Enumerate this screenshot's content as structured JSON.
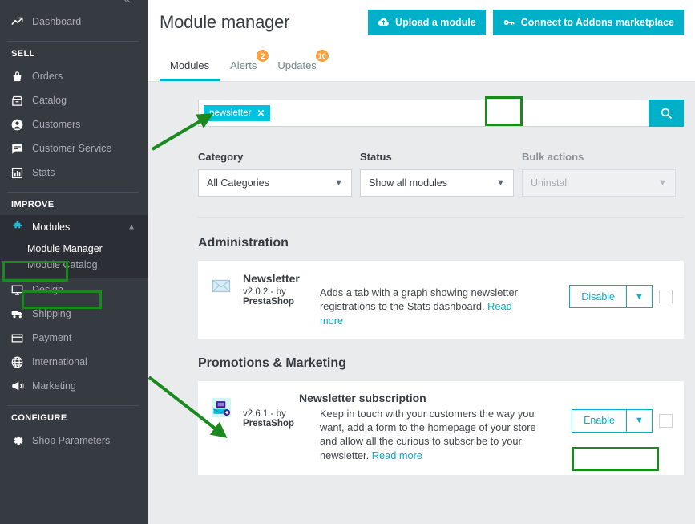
{
  "sidebar": {
    "collapse_icon": "double-chevron-left",
    "dashboard": {
      "label": "Dashboard",
      "icon": "trending-up-icon"
    },
    "sell_header": "SELL",
    "sell_items": [
      {
        "label": "Orders",
        "icon": "basket-icon"
      },
      {
        "label": "Catalog",
        "icon": "store-icon"
      },
      {
        "label": "Customers",
        "icon": "user-circle-icon"
      },
      {
        "label": "Customer Service",
        "icon": "chat-icon"
      },
      {
        "label": "Stats",
        "icon": "bar-chart-icon"
      }
    ],
    "improve_header": "IMPROVE",
    "modules": {
      "label": "Modules",
      "icon": "puzzle-icon"
    },
    "modules_sub": [
      {
        "label": "Module Manager",
        "active": true
      },
      {
        "label": "Module Catalog",
        "active": false
      }
    ],
    "improve_items": [
      {
        "label": "Design",
        "icon": "monitor-icon"
      },
      {
        "label": "Shipping",
        "icon": "truck-icon"
      },
      {
        "label": "Payment",
        "icon": "credit-card-icon"
      },
      {
        "label": "International",
        "icon": "globe-icon"
      },
      {
        "label": "Marketing",
        "icon": "megaphone-icon"
      }
    ],
    "configure_header": "CONFIGURE",
    "configure_items": [
      {
        "label": "Shop Parameters",
        "icon": "gear-icon"
      }
    ]
  },
  "header": {
    "title": "Module manager",
    "upload_label": "Upload a module",
    "connect_label": "Connect to Addons marketplace"
  },
  "tabs": [
    {
      "label": "Modules",
      "badge": "",
      "active": true
    },
    {
      "label": "Alerts",
      "badge": "2",
      "active": false
    },
    {
      "label": "Updates",
      "badge": "10",
      "active": false
    }
  ],
  "search": {
    "tag": "newsletter",
    "remove_icon": "close-icon",
    "search_icon": "search-icon",
    "placeholder": ""
  },
  "filters": [
    {
      "label": "Category",
      "value": "All Categories",
      "disabled": false
    },
    {
      "label": "Status",
      "value": "Show all modules",
      "disabled": false
    },
    {
      "label": "Bulk actions",
      "value": "Uninstall",
      "disabled": true
    }
  ],
  "sections": [
    {
      "title": "Administration",
      "modules": [
        {
          "name": "Newsletter",
          "version": "v2.0.2 - by",
          "author": "PrestaShop",
          "description": "Adds a tab with a graph showing newsletter registrations to the Stats dashboard. ",
          "read_more": "Read more",
          "action_label": "Disable",
          "caret_icon": "chevron-down-icon",
          "icon": "envelope-icon"
        }
      ]
    },
    {
      "title": "Promotions & Marketing",
      "modules": [
        {
          "name": "Newsletter subscription",
          "version": "v2.6.1 - by",
          "author": "PrestaShop",
          "description": "Keep in touch with your customers the way you want, add a form to the homepage of your store and allow all the curious to subscribe to your newsletter. ",
          "read_more": "Read more",
          "action_label": "Enable",
          "caret_icon": "chevron-down-icon",
          "icon": "newsletter-subscription-icon"
        }
      ]
    }
  ],
  "colors": {
    "accent": "#00b0c8",
    "tag": "#00c1de",
    "sidebar": "#363a41",
    "sidebar_dark": "#2b2e34",
    "badge": "#f4a340",
    "annotation": "#1a8a1f",
    "page_bg": "#eaebec"
  }
}
